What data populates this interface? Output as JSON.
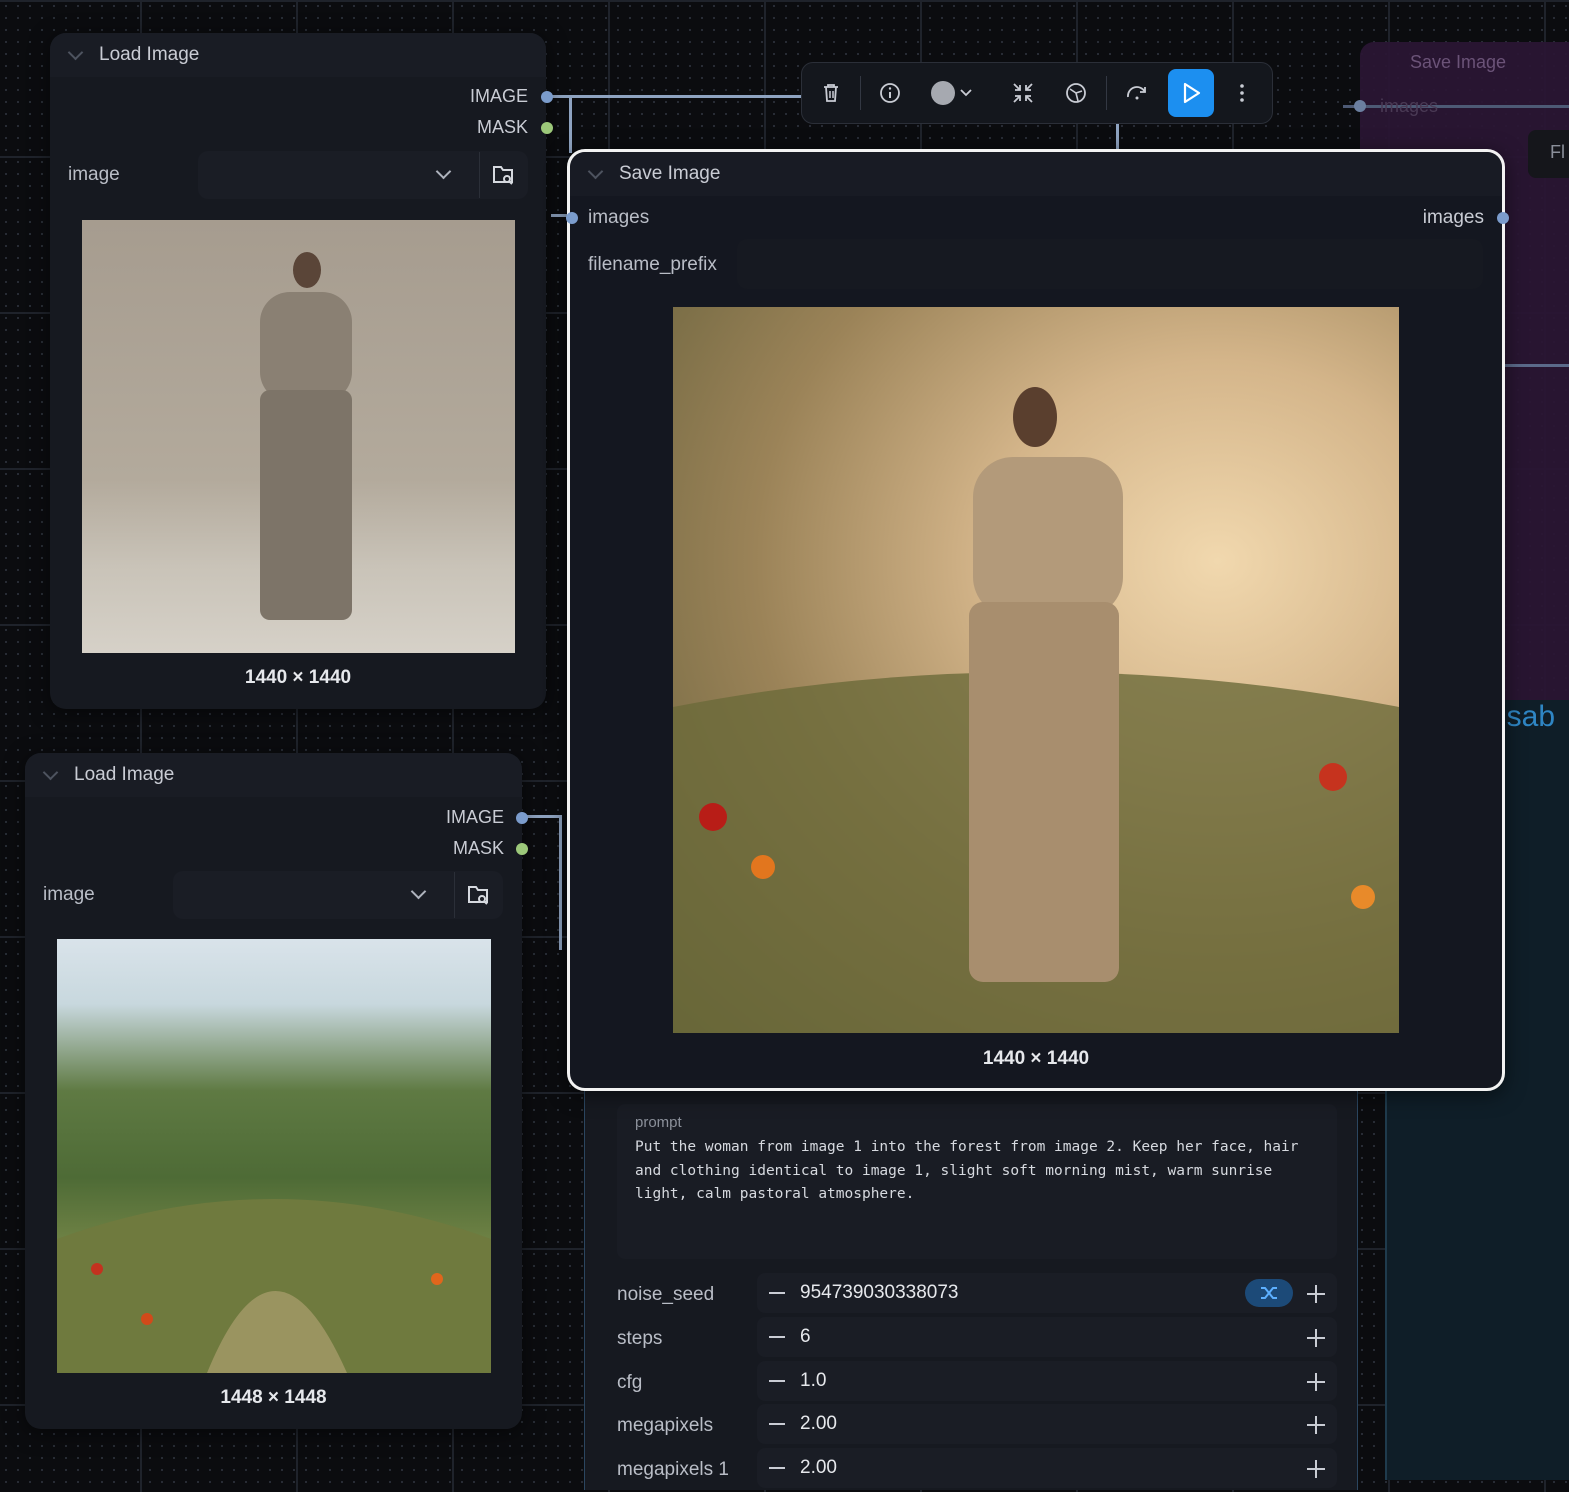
{
  "nodes": {
    "load_image_1": {
      "title": "Load Image",
      "outputs": [
        "IMAGE",
        "MASK"
      ],
      "widget_label": "image",
      "dimensions": "1440 × 1440"
    },
    "load_image_2": {
      "title": "Load Image",
      "outputs": [
        "IMAGE",
        "MASK"
      ],
      "widget_label": "image",
      "dimensions": "1448 × 1448"
    },
    "save_image": {
      "title": "Save Image",
      "input": "images",
      "output": "images",
      "widget_label": "filename_prefix",
      "dimensions": "1440 × 1440"
    },
    "background_save_image": {
      "title": "Save Image",
      "input": "images",
      "partial_text_1": "Fl",
      "partial_text_2": "isab"
    },
    "sampler": {
      "prompt_label": "prompt",
      "prompt_text": "Put the woman from image 1 into the forest from image 2. Keep her face, hair and clothing identical to image 1, slight soft morning mist, warm sunrise light, calm pastoral atmosphere.",
      "fields": [
        {
          "label": "noise_seed",
          "value": "954739030338073"
        },
        {
          "label": "steps",
          "value": "6"
        },
        {
          "label": "cfg",
          "value": "1.0"
        },
        {
          "label": "megapixels",
          "value": "2.00"
        },
        {
          "label": "megapixels 1",
          "value": "2.00"
        }
      ]
    }
  },
  "toolbar": {
    "icons": [
      "trash-icon",
      "info-icon",
      "color-dot-icon",
      "chevron-down-icon",
      "collapse-icon",
      "bypass-icon",
      "redo-icon",
      "run-icon",
      "more-icon"
    ]
  },
  "colors": {
    "accent": "#1c8ff0",
    "link": "#8ea3c0",
    "mask_dot": "#9cc87a",
    "image_dot": "#7b9ccc",
    "group_purple": "#2a1634"
  }
}
